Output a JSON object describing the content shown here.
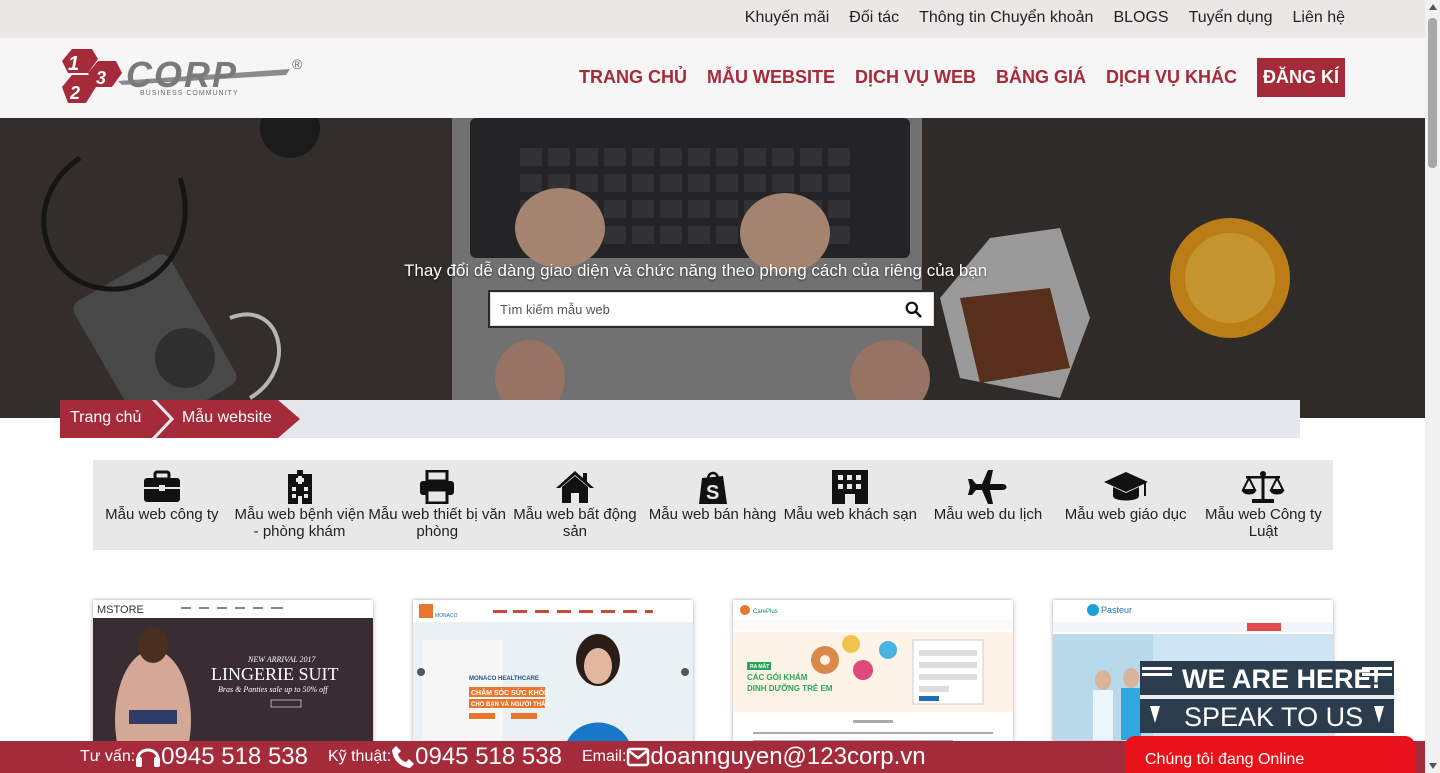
{
  "topbar": {
    "links": [
      "Khuyến mãi",
      "Đối tác",
      "Thông tin Chuyển khoản",
      "BLOGS",
      "Tuyển dụng",
      "Liên hệ"
    ]
  },
  "header": {
    "logo": {
      "digits": "123",
      "text": "CORP",
      "registered": "®",
      "tagline": "BUSINESS COMMUNITY"
    },
    "nav": [
      "TRANG CHỦ",
      "MẪU WEBSITE",
      "DỊCH VỤ WEB",
      "BẢNG GIÁ",
      "DỊCH VỤ KHÁC"
    ],
    "register_label": "ĐĂNG KÍ"
  },
  "hero": {
    "title": "Thay đổi dễ dàng giao diện và chức năng theo phong cách của riêng của bạn",
    "search_placeholder": "Tìm kiếm mẫu web"
  },
  "breadcrumb": {
    "home": "Trang chủ",
    "current": "Mẫu website"
  },
  "categories": [
    {
      "label": "Mẫu web công ty",
      "icon": "briefcase-icon"
    },
    {
      "label": "Mẫu web bệnh viện - phòng khám",
      "icon": "hospital-icon"
    },
    {
      "label": "Mẫu web thiết bị văn phòng",
      "icon": "printer-icon"
    },
    {
      "label": "Mẫu web bất động sản",
      "icon": "home-icon"
    },
    {
      "label": "Mẫu web bán hàng",
      "icon": "shopping-bag-icon"
    },
    {
      "label": "Mẫu web khách sạn",
      "icon": "building-icon"
    },
    {
      "label": "Mẫu web du lịch",
      "icon": "plane-icon"
    },
    {
      "label": "Mẫu web giáo dục",
      "icon": "graduation-cap-icon"
    },
    {
      "label": "Mẫu web Công ty Luật",
      "icon": "balance-scale-icon"
    }
  ],
  "thumbnails": [
    {
      "brand": "MSTORE",
      "headline": "NEW ARRIVAL 2017",
      "title": "LINGERIE SUIT",
      "subtitle": "Bras & Panties sale up to 50% off"
    },
    {
      "brand": "MONACO HEALTHCARE",
      "headline": "CHĂM SÓC SỨC KHỎE",
      "subtitle": "CHO BẠN VÀ NGƯỜI THÂN"
    },
    {
      "brand": "CarePlus",
      "headline": "RA MẮT",
      "title": "CÁC GÓI KHÁM",
      "subtitle": "DINH DƯỠNG TRẺ EM"
    },
    {
      "brand": "Pasteur"
    }
  ],
  "footer": {
    "consult_label": "Tư vấn:",
    "consult_phone": "0945 518 538",
    "tech_label": "Kỹ thuật:",
    "tech_phone": "0945 518 538",
    "email_label": "Email:",
    "email": "doannguyen@123corp.vn"
  },
  "chat_widget": {
    "line1": "WE ARE HERE!",
    "line2": "SPEAK TO US",
    "status": "Chúng tôi đang Online"
  },
  "colors": {
    "brand": "#a52a3a",
    "topbar_bg": "#ebe7e7",
    "chat_red": "#e8121a",
    "chat_dark": "#2b3c4d"
  }
}
